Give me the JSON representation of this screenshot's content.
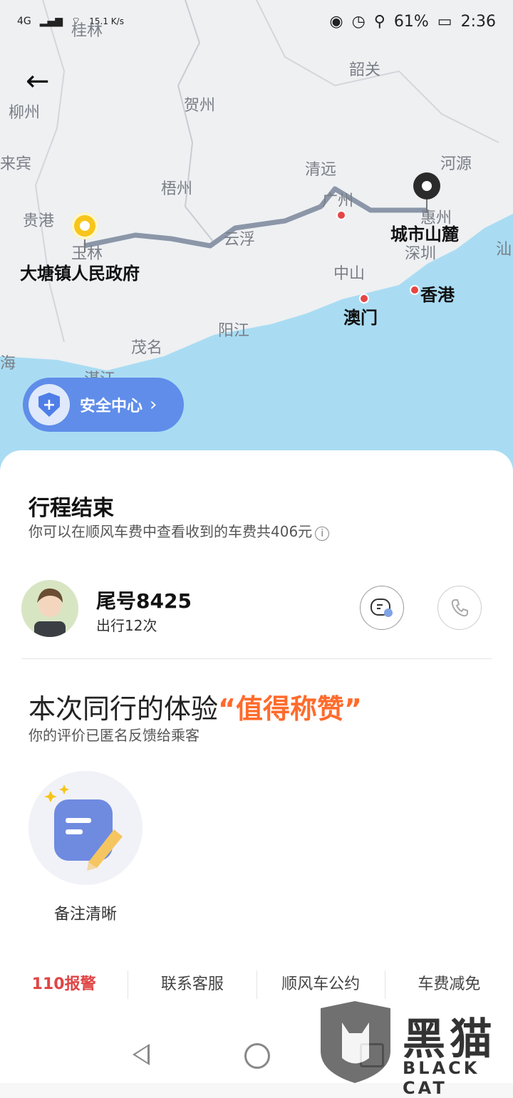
{
  "status_bar": {
    "network": "4G",
    "speed": "15.1",
    "speed_unit": "K/s",
    "battery": "61%",
    "time": "2:36"
  },
  "map": {
    "cities": [
      "桂林",
      "柳州",
      "贺州",
      "韶关",
      "来宾",
      "河源",
      "清远",
      "梧州",
      "贵港",
      "广州",
      "惠州",
      "云浮",
      "深圳",
      "汕",
      "中山",
      "阳江",
      "茂名",
      "海",
      "湛江",
      "玉林"
    ],
    "start_label": "大塘镇人民政府",
    "end_label": "城市山麓",
    "macau": "澳门",
    "hongkong": "香港"
  },
  "safety": {
    "label": "安全中心"
  },
  "trip": {
    "title": "行程结束",
    "subtitle": "你可以在顺风车费中查看收到的车费共406元"
  },
  "passenger": {
    "name": "尾号8425",
    "trips": "出行12次"
  },
  "rating": {
    "prefix": "本次同行的体验",
    "highlight": "“值得称赞”",
    "subtitle": "你的评价已匿名反馈给乘客"
  },
  "tag": {
    "label": "备注清晰"
  },
  "footer": {
    "items": [
      "110报警",
      "联系客服",
      "顺风车公约",
      "车费减免"
    ]
  },
  "watermark": {
    "text": "黑猫",
    "sub": "BLACK CAT"
  },
  "colors": {
    "accent": "#ff6b2c",
    "safety": "#5f8de9",
    "alert": "#e04545"
  }
}
